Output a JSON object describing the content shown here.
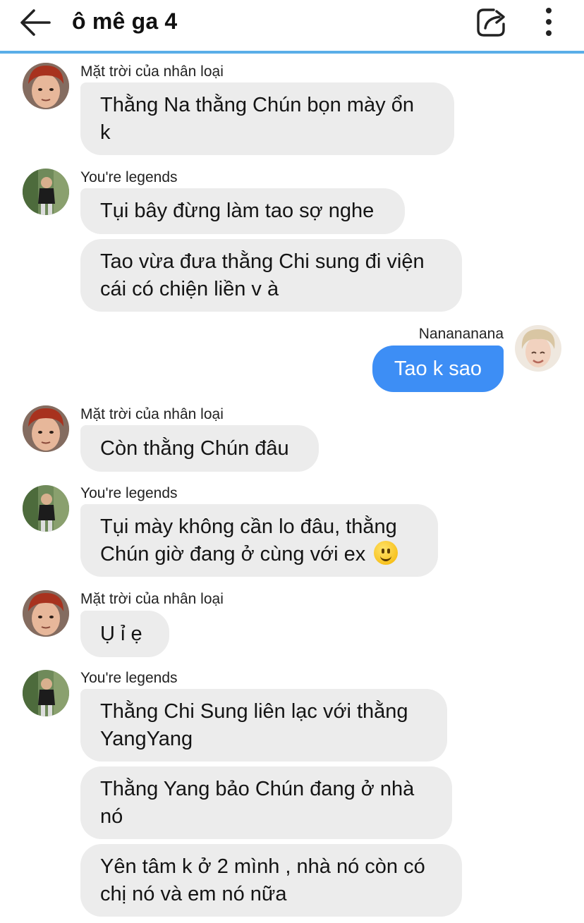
{
  "header": {
    "title": "ô mê ga 4",
    "back_icon": "arrow-left-icon",
    "share_icon": "share-icon",
    "more_icon": "more-vertical-icon",
    "accent_color": "#5aaee8"
  },
  "colors": {
    "my_bubble": "#3d8ef5",
    "other_bubble": "#ececec"
  },
  "messages": [
    {
      "sender": "Mặt trời của nhân loại",
      "lines": [
        "Thằng Na thằng Chún bọn mày ổn",
        "k"
      ]
    },
    {
      "sender": "You're legends",
      "lines": [
        "Tụi bây đừng làm tao sợ nghe"
      ]
    },
    {
      "lines": [
        "Tao vừa đưa thằng Chi sung đi viện",
        "cái có chiện liền v à"
      ]
    },
    {
      "sender": "Nanananana",
      "mine": true,
      "lines": [
        "Tao k sao"
      ]
    },
    {
      "sender": "Mặt trời của nhân loại",
      "lines": [
        "Còn thằng Chún đâu"
      ]
    },
    {
      "sender": "You're legends",
      "lines": [
        "Tụi mày không cần lo đâu, thằng",
        "Chún  giờ đang ở cùng với ex"
      ],
      "emoji": "slightly-smiling-face-emoji"
    },
    {
      "sender": "Mặt trời của nhân loại",
      "lines": [
        "Ụ  ỉ ẹ"
      ]
    },
    {
      "sender": "You're legends",
      "lines": [
        "Thằng Chi Sung liên lạc với thằng",
        "YangYang"
      ]
    },
    {
      "lines": [
        "Thằng Yang bảo Chún đang ở nhà",
        "nó"
      ]
    },
    {
      "lines": [
        "Yên tâm k ở 2 mình , nhà nó còn có",
        "chị nó và em nó nữa"
      ]
    }
  ]
}
